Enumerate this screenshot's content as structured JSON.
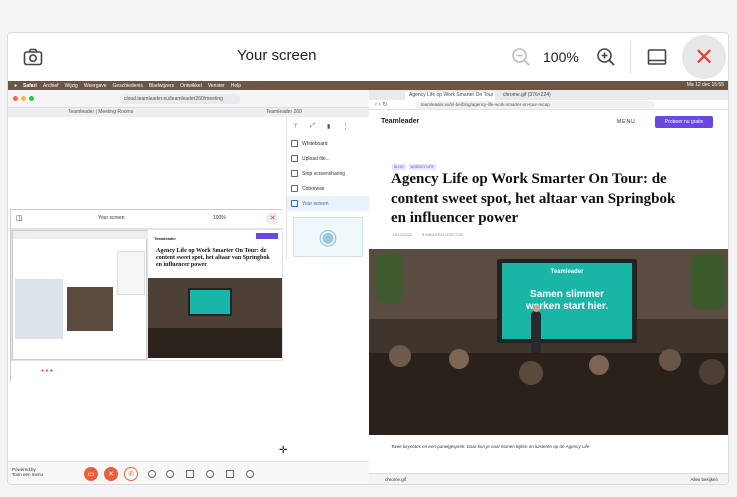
{
  "viewer": {
    "title": "Your screen",
    "zoom": "100%",
    "icons": [
      "camera-icon",
      "zoom-out-icon",
      "zoom-in-icon",
      "fullscreen-icon",
      "close-icon"
    ]
  },
  "mac_menu": {
    "items": [
      "Safari",
      "Archief",
      "Wijzig",
      "Weergave",
      "Geschiedenis",
      "Bladwijzers",
      "Ontwikkel",
      "Venster",
      "Help"
    ],
    "clock": "Ma 12 dec 15:55"
  },
  "left_browser": {
    "address": "cloud.teamleader.eu/teamleader260/meeting",
    "tabs": [
      "Teamleader | Meeting Rooms",
      "Teamleader 260"
    ]
  },
  "share_menu": {
    "items": [
      "Whiteboard",
      "Upload file...",
      "Stop screensharing",
      "Coborwse",
      "Your screen"
    ]
  },
  "nested_view": {
    "title": "Your screen",
    "zoom": "100%",
    "headline": "Agency Life op Work Smarter On Tour: de content sweet spot, het altaar van Springbok en influencer power"
  },
  "taskbar": {
    "label_line1": "Powered by",
    "label_line2": "Toon een menu"
  },
  "right_browser": {
    "tabs": [
      "Agency Life op Work Smarter On Tour",
      "chrome.gif (376×224)"
    ],
    "address": "teamleader.eu/nl-be/blog/agency-life-work-smarter-on-tour-recap",
    "logo": "Teamleader",
    "menu": "MENU",
    "cta": "Probeer nu gratis",
    "tags": [
      "BLOG",
      "AGENCY LIFE"
    ],
    "headline": "Agency Life op Work Smarter On Tour: de content sweet spot, het altaar van Springbok en influencer power",
    "meta": [
      "14/12/2022",
      "5 MINUTEN LEESTIJD"
    ],
    "screen_text_line1": "Samen slimmer",
    "screen_text_line2": "werken start hier.",
    "screen_logo": "Teamleader",
    "caption": "Twee keynotes en een panelgesprek. Daar kon je naar komen kijken en luisteren op de Agency Life-",
    "download": "chrome.gif",
    "download_link": "Alles bekijken"
  }
}
